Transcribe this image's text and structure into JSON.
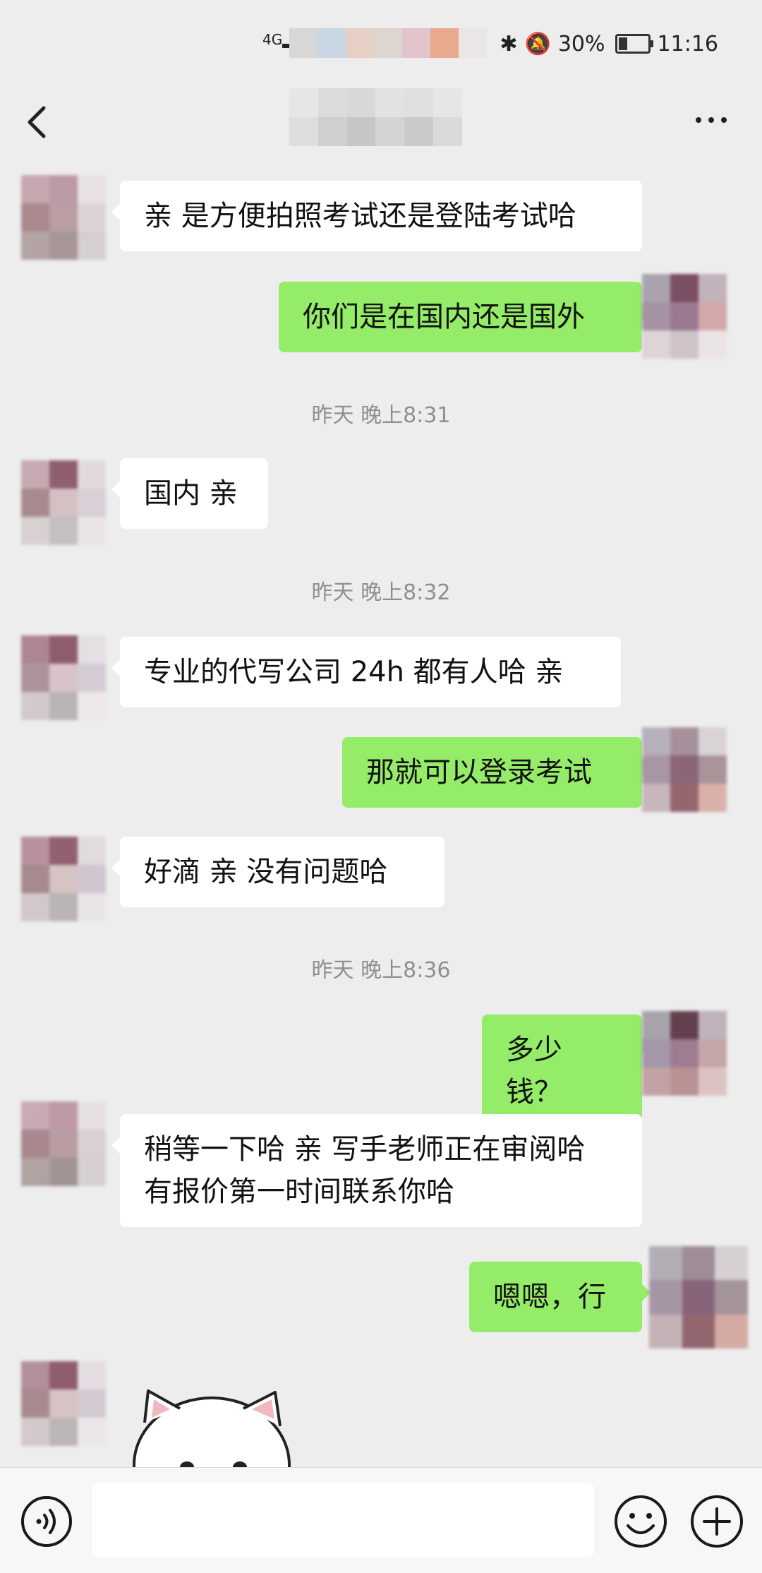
{
  "status_bar": {
    "network": "4G",
    "battery_percent": "30%",
    "battery_level": 0.3,
    "time": "11:16"
  },
  "nav": {
    "title": ""
  },
  "messages": [
    {
      "side": "left",
      "text": "亲 是方便拍照考试还是登陆考试哈"
    },
    {
      "side": "right",
      "text": "你们是在国内还是国外"
    },
    {
      "type": "time",
      "text": "昨天 晚上8:31"
    },
    {
      "side": "left",
      "text": "国内 亲"
    },
    {
      "type": "time",
      "text": "昨天 晚上8:32"
    },
    {
      "side": "left",
      "text": "专业的代写公司 24h 都有人哈 亲"
    },
    {
      "side": "right",
      "text": "那就可以登录考试"
    },
    {
      "side": "left",
      "text": "好滴 亲 没有问题哈"
    },
    {
      "type": "time",
      "text": "昨天 晚上8:36"
    },
    {
      "side": "right",
      "text": "多少钱？"
    },
    {
      "side": "left",
      "text": "稍等一下哈 亲 写手老师正在审阅哈 有报价第一时间联系你哈"
    },
    {
      "side": "right",
      "text": "嗯嗯，行"
    }
  ],
  "input": {
    "value": "",
    "placeholder": ""
  },
  "colors": {
    "background": "#ededed",
    "bubble_left": "#ffffff",
    "bubble_right": "#95ec69",
    "timestamp": "#8f8f8f"
  },
  "icons": {
    "back": "chevron-left-icon",
    "more": "more-icon",
    "voice": "voice-icon",
    "emoji": "emoji-icon",
    "plus": "plus-icon"
  }
}
